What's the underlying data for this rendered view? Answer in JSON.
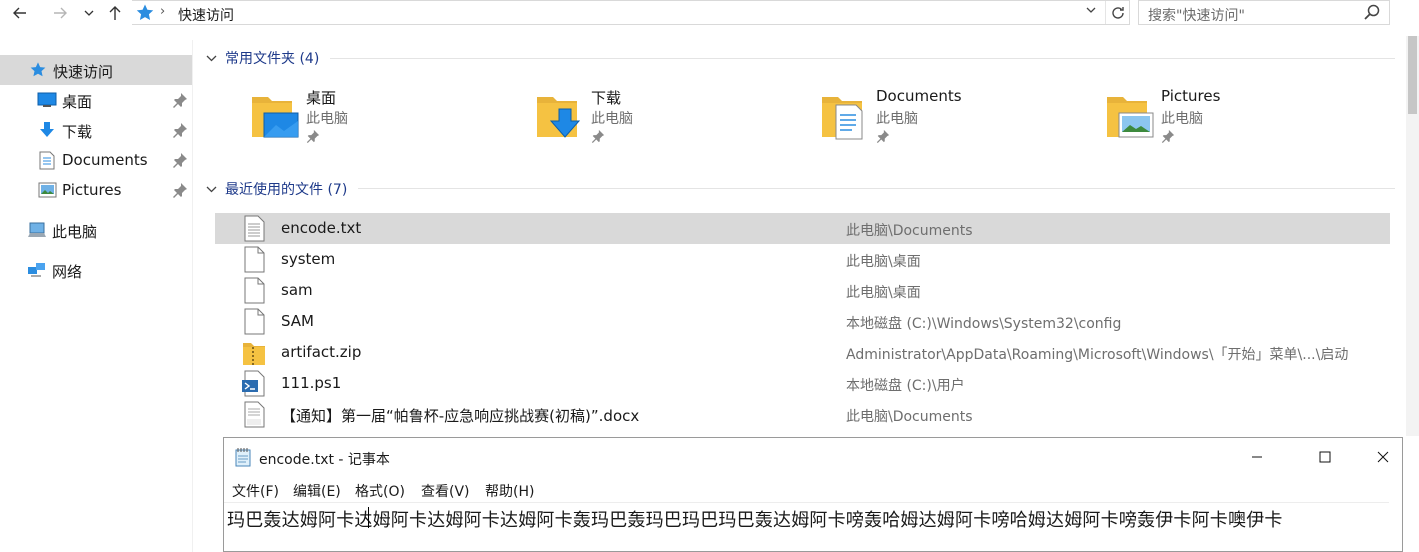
{
  "explorer": {
    "nav": {
      "back_icon": "arrow-left-icon",
      "forward_icon": "arrow-right-icon",
      "recent_icon": "chevron-down-icon",
      "up_icon": "arrow-up-icon"
    },
    "address": {
      "crumb": "快速访问",
      "location_icon": "quick-access-star-icon"
    },
    "search": {
      "placeholder": "搜索\"快速访问\""
    },
    "colors": {
      "accent": "#1e3a8a",
      "selection": "#d9d9d9",
      "folder": "#f5c242"
    }
  },
  "sidebar": {
    "items": [
      {
        "label": "快速访问",
        "icon": "quick-access-star-icon",
        "selected": true
      },
      {
        "label": "桌面",
        "icon": "desktop-icon",
        "pinned": true
      },
      {
        "label": "下载",
        "icon": "download-icon",
        "pinned": true
      },
      {
        "label": "Documents",
        "icon": "documents-icon",
        "pinned": true
      },
      {
        "label": "Pictures",
        "icon": "pictures-icon",
        "pinned": true
      },
      {
        "label": "此电脑",
        "icon": "this-pc-icon"
      },
      {
        "label": "网络",
        "icon": "network-icon"
      }
    ]
  },
  "frequent": {
    "header": "常用文件夹 (4)",
    "folders": [
      {
        "name": "桌面",
        "location": "此电脑",
        "icon": "desktop-folder-icon"
      },
      {
        "name": "下载",
        "location": "此电脑",
        "icon": "download-folder-icon"
      },
      {
        "name": "Documents",
        "location": "此电脑",
        "icon": "documents-folder-icon"
      },
      {
        "name": "Pictures",
        "location": "此电脑",
        "icon": "pictures-folder-icon"
      }
    ]
  },
  "recent": {
    "header": "最近使用的文件 (7)",
    "files": [
      {
        "name": "encode.txt",
        "path": "此电脑\\Documents",
        "icon": "text-file-icon",
        "selected": true
      },
      {
        "name": "system",
        "path": "此电脑\\桌面",
        "icon": "blank-file-icon"
      },
      {
        "name": "sam",
        "path": "此电脑\\桌面",
        "icon": "blank-file-icon"
      },
      {
        "name": "SAM",
        "path": "本地磁盘 (C:)\\Windows\\System32\\config",
        "icon": "blank-file-icon"
      },
      {
        "name": "artifact.zip",
        "path": "Administrator\\AppData\\Roaming\\Microsoft\\Windows\\「开始」菜单\\...\\启动",
        "icon": "zip-file-icon"
      },
      {
        "name": "111.ps1",
        "path": "本地磁盘 (C:)\\用户",
        "icon": "powershell-file-icon"
      },
      {
        "name": "【通知】第一届“帕鲁杯-应急响应挑战赛(初稿)”.docx",
        "path": "此电脑\\Documents",
        "icon": "docx-file-icon"
      }
    ]
  },
  "notepad": {
    "title": "encode.txt - 记事本",
    "icon": "notepad-icon",
    "menu": [
      "文件(F)",
      "编辑(E)",
      "格式(O)",
      "查看(V)",
      "帮助(H)"
    ],
    "content": "玛巴轰达姆阿卡达姆阿卡达姆阿卡达姆阿卡轰玛巴轰玛巴玛巴玛巴轰达姆阿卡嗙轰哈姆达姆阿卡嗙哈姆达姆阿卡嗙轰伊卡阿卡噢伊卡",
    "buttons": {
      "minimize": "minimize-icon",
      "maximize": "maximize-icon",
      "close": "close-icon"
    }
  }
}
